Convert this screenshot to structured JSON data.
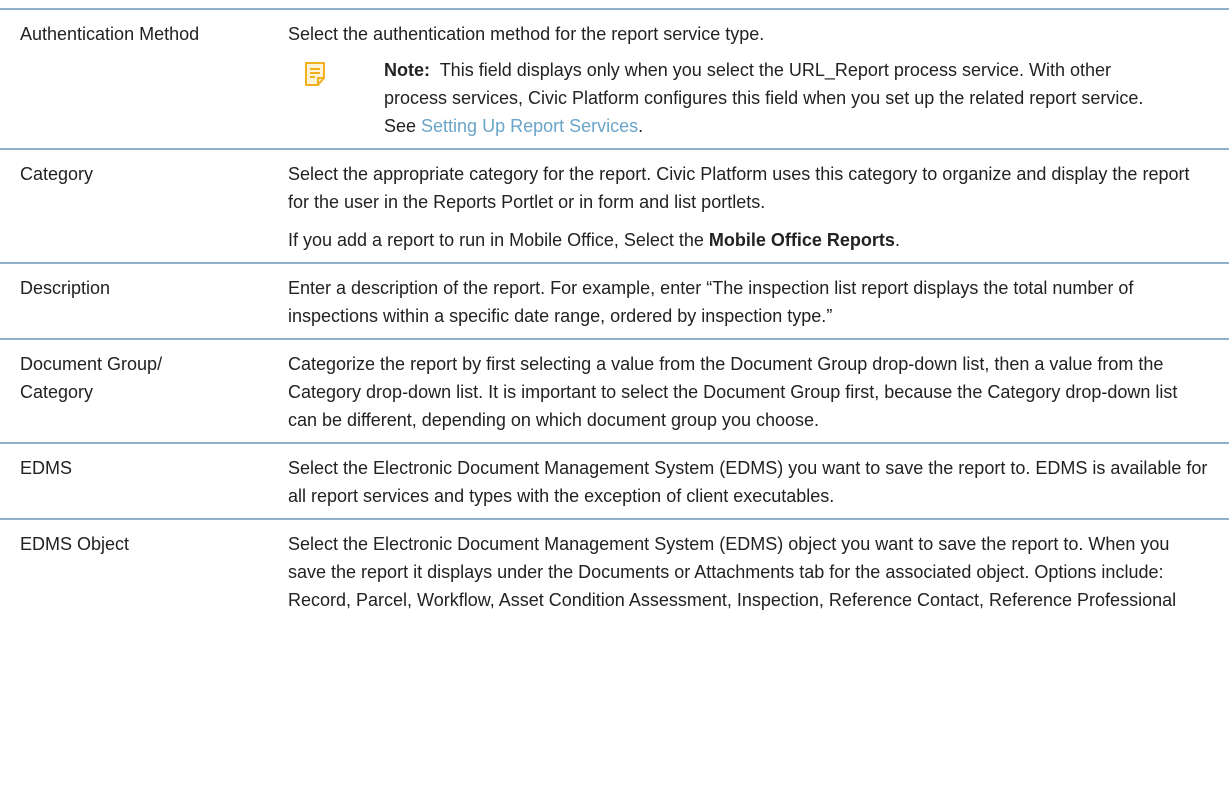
{
  "rows": [
    {
      "name": "Authentication Method",
      "desc": "Select the authentication method for the report service type.",
      "note": {
        "label": "Note:",
        "text": "This field displays only when you select the URL_Report process service. With other process services, Civic Platform configures this field when you set up the related report service. See ",
        "link": "Setting Up Report Services",
        "end": "."
      }
    },
    {
      "name": "Category",
      "desc": "Select the appropriate category for the report. Civic Platform uses this category to organize and display the report for the user in the Reports Portlet or in form and list portlets.",
      "desc2_pre": "If you add a report to run in Mobile Office, Select the ",
      "desc2_bold": "Mobile Office Reports",
      "desc2_end": "."
    },
    {
      "name": "Description",
      "desc": "Enter a description of the report. For example, enter “The inspection list report displays the total number of inspections within a specific date range, ordered by inspection type.”"
    },
    {
      "name": "Document Group/ Category",
      "desc": "Categorize the report by first selecting a value from the Document Group drop-down list, then a value from the Category drop-down list. It is important to select the Document Group first, because the Category drop-down list can be different, depending on which document group you choose."
    },
    {
      "name": "EDMS",
      "desc": "Select the Electronic Document Management System (EDMS) you want to save the report to. EDMS is available for all report services and types with the exception of client executables."
    },
    {
      "name": "EDMS Object",
      "desc": "Select the Electronic Document Management System (EDMS) object you want to save the report to. When you save the report it displays under the Documents or Attachments tab for the associated object. Options include: Record, Parcel, Workflow, Asset Condition Assessment, Inspection, Reference Contact, Reference Professional"
    }
  ],
  "icons": {
    "note": "note-icon",
    "note_color": "#f2b01e"
  },
  "colors": {
    "rule": "#8fb1cc",
    "link": "#6aa5c9",
    "text": "#222222"
  }
}
